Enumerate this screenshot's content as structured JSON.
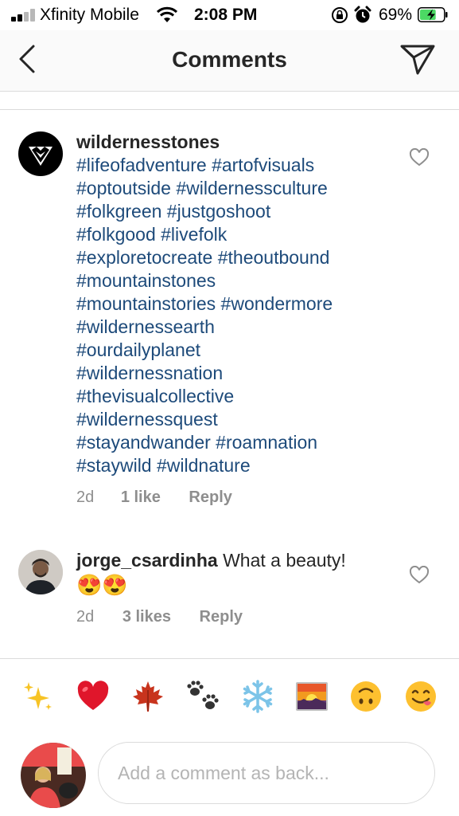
{
  "status_bar": {
    "carrier": "Xfinity Mobile",
    "time": "2:08 PM",
    "battery_percent": "69%",
    "battery_level": 0.69,
    "signal_bars_active": 2,
    "icons": [
      "signal-icon",
      "wifi-icon",
      "rotation-lock-icon",
      "alarm-icon",
      "battery-charging-icon"
    ]
  },
  "nav": {
    "title": "Comments",
    "back_icon": "chevron-left-icon",
    "direct_icon": "paper-plane-icon"
  },
  "comments": [
    {
      "username": "wildernesstones",
      "text": "#lifeofadventure #artofvisuals #optoutside #wildernessculture #folkgreen #justgoshoot #folkgood #livefolk #exploretocreate #theoutbound #mountainstones #mountainstories #wondermore #wildernessearth #ourdailyplanet #wildernessnation #thevisualcollective #wildernessquest #stayandwander #roamnation #staywild #wildnature",
      "lines": [
        "#lifeofadventure #artofvisuals",
        "#optoutside #wildernessculture",
        "#folkgreen #justgoshoot",
        "#folkgood #livefolk",
        "#exploretocreate #theoutbound",
        "#mountainstones",
        "#mountainstories #wondermore",
        "#wildernessearth",
        "#ourdailyplanet",
        "#wildernessnation",
        "#thevisualcollective",
        "#wildernessquest",
        "#stayandwander #roamnation",
        "#staywild #wildnature"
      ],
      "time": "2d",
      "likes": "1 like",
      "reply": "Reply"
    },
    {
      "username": "jorge_csardinha",
      "text": "What a beauty!",
      "emoji": "😍😍",
      "time": "2d",
      "likes": "3 likes",
      "reply": "Reply"
    }
  ],
  "emoji_bar": [
    "✨",
    "❤️",
    "🍁",
    "🐾",
    "❄️",
    "🌇",
    "🙃",
    "😋"
  ],
  "composer": {
    "placeholder": "Add a comment as back..."
  },
  "colors": {
    "hashtag": "#1d4a7a",
    "muted": "#8e8e8e",
    "battery_green": "#4cd964",
    "nav_bg": "#fafafa"
  }
}
